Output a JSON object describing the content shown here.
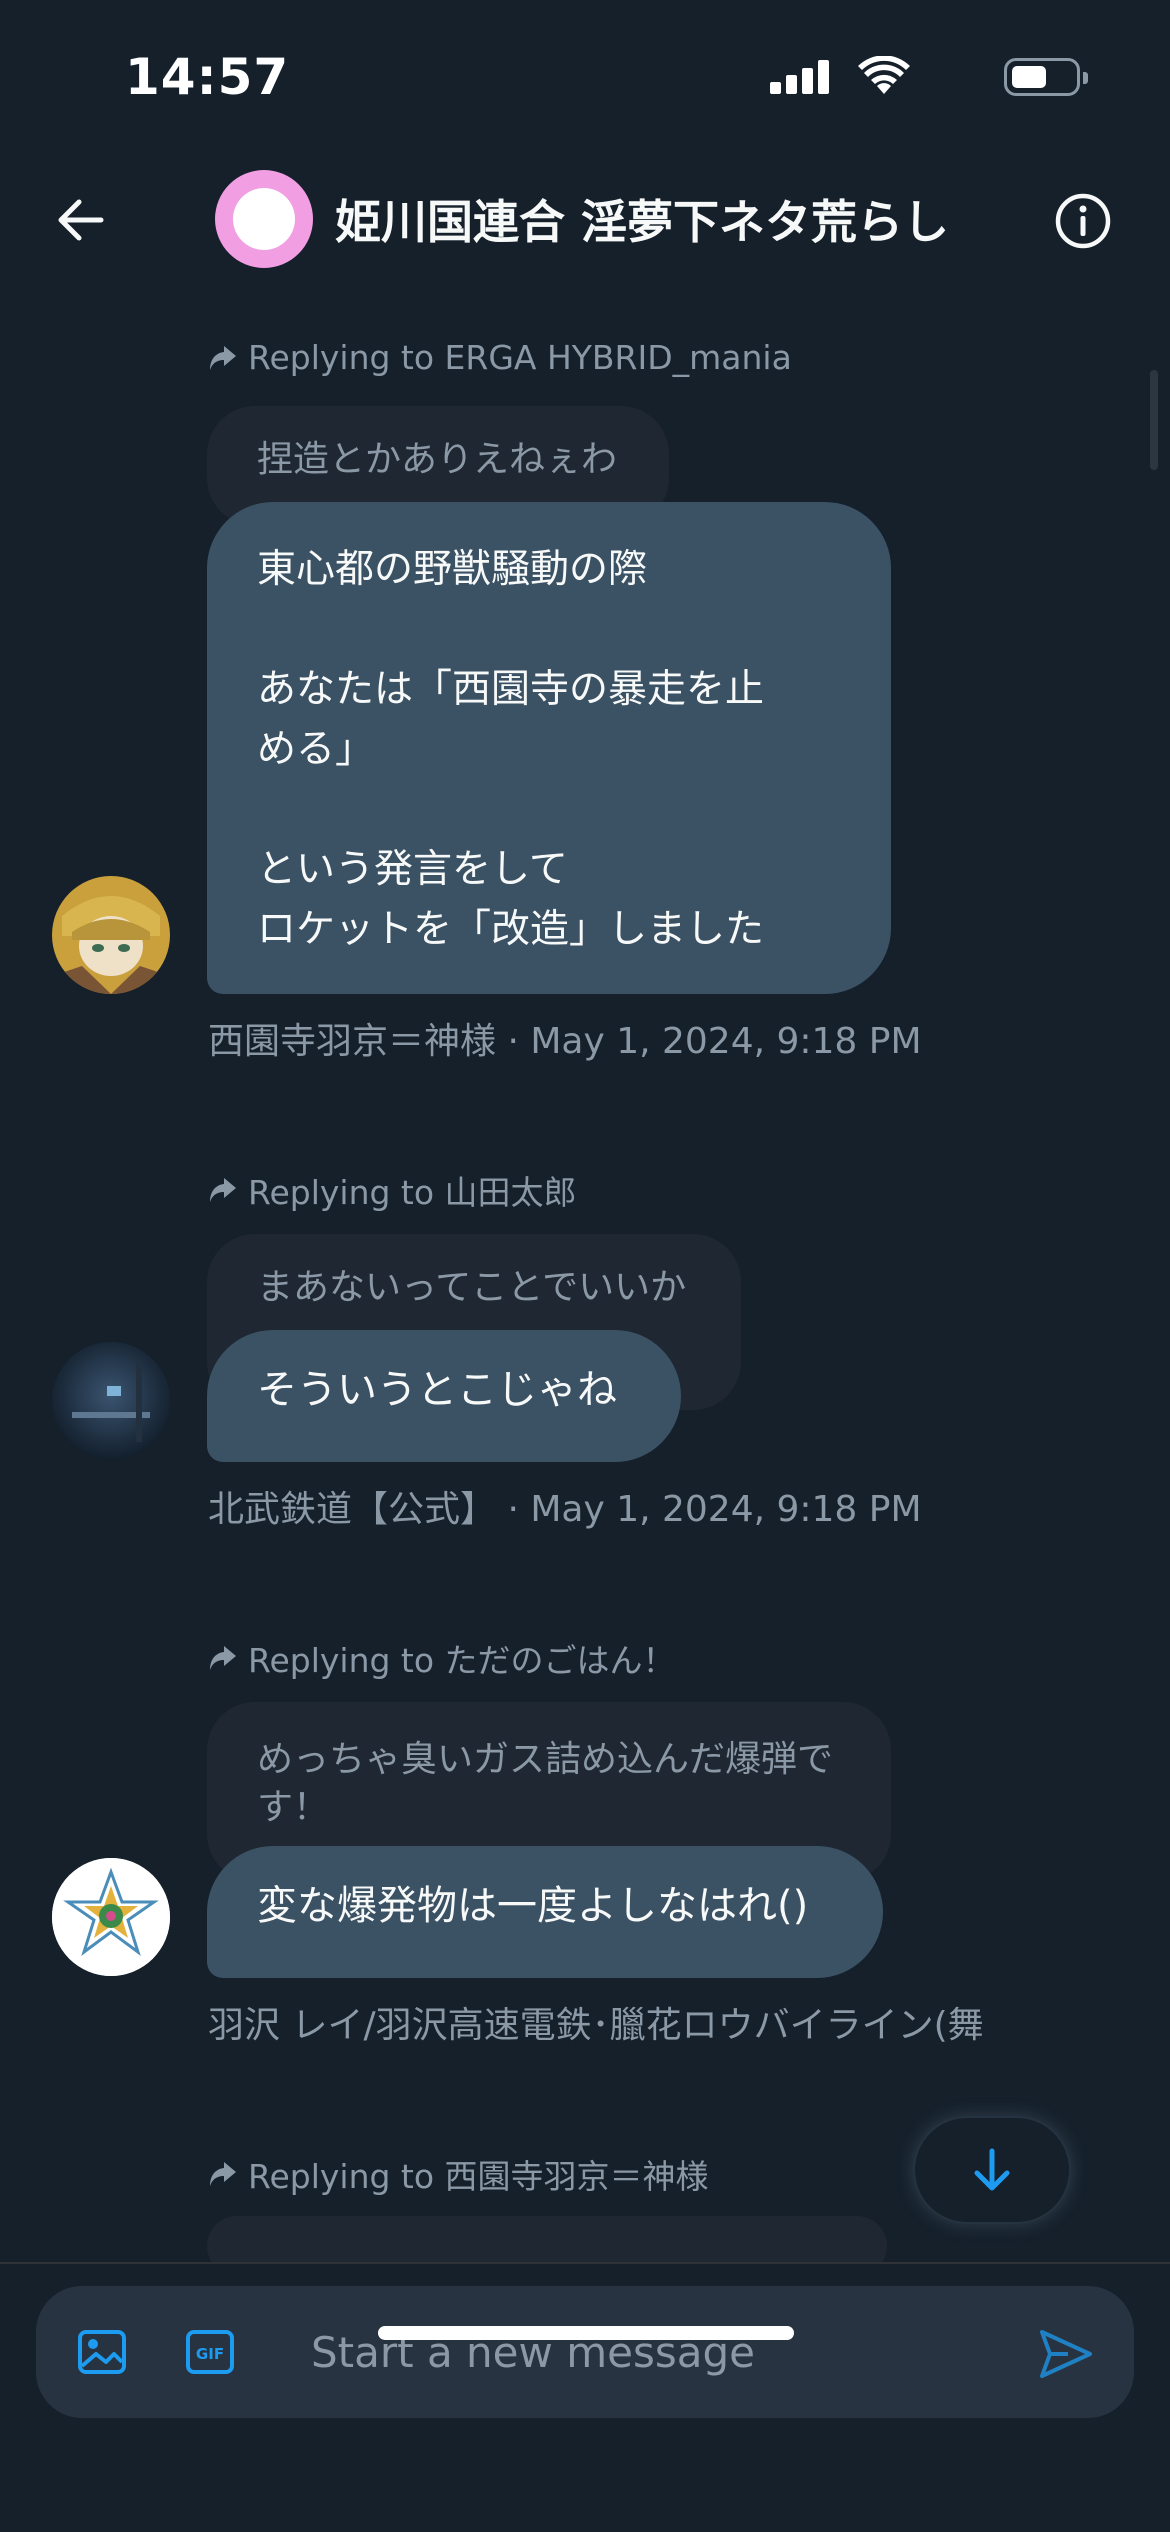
{
  "status_bar": {
    "time": "14:57"
  },
  "header": {
    "title": "姫川国連合 淫夢下ネタ荒らし"
  },
  "messages": [
    {
      "replying_to": "Replying to ERGA HYBRID_mania",
      "quoted": "捏造とかありえねぇわ",
      "bubble_lines": [
        "東心都の野獣騒動の際",
        "",
        "あなたは「西園寺の暴走を止",
        "める」",
        "",
        "という発言をして",
        "ロケットを「改造」しました"
      ],
      "meta": "西園寺羽京＝神様 · May 1, 2024, 9:18 PM"
    },
    {
      "replying_to": "Replying to 山田太郎",
      "quoted": "まあないってことでいいか",
      "bubble_lines": [
        "そういうとこじゃね"
      ],
      "meta": "北武鉄道【公式】 · May 1, 2024, 9:18 PM"
    },
    {
      "replying_to": "Replying to ただのごはん！",
      "quoted_lines": [
        "めっちゃ臭いガス詰め込んだ爆弾で",
        "す！"
      ],
      "bubble_lines": [
        "変な爆発物は一度よしなはれ()"
      ],
      "meta": "羽沢 レイ/羽沢高速電鉄･臘花ロウバイライン(舞"
    },
    {
      "replying_to": "Replying to 西園寺羽京＝神様"
    }
  ],
  "composer": {
    "placeholder": "Start a new message"
  },
  "icons": {
    "back": "arrow-left-icon",
    "info": "info-circle-icon",
    "reply": "reply-arrow-icon",
    "scroll_down": "arrow-down-icon",
    "image": "image-icon",
    "gif": "gif-icon",
    "send": "send-icon"
  },
  "colors": {
    "background": "#15202b",
    "bubble": "#3b5164",
    "quoted": "#1e2732",
    "accent": "#1d9bf0",
    "muted_text": "#8b98a5"
  }
}
